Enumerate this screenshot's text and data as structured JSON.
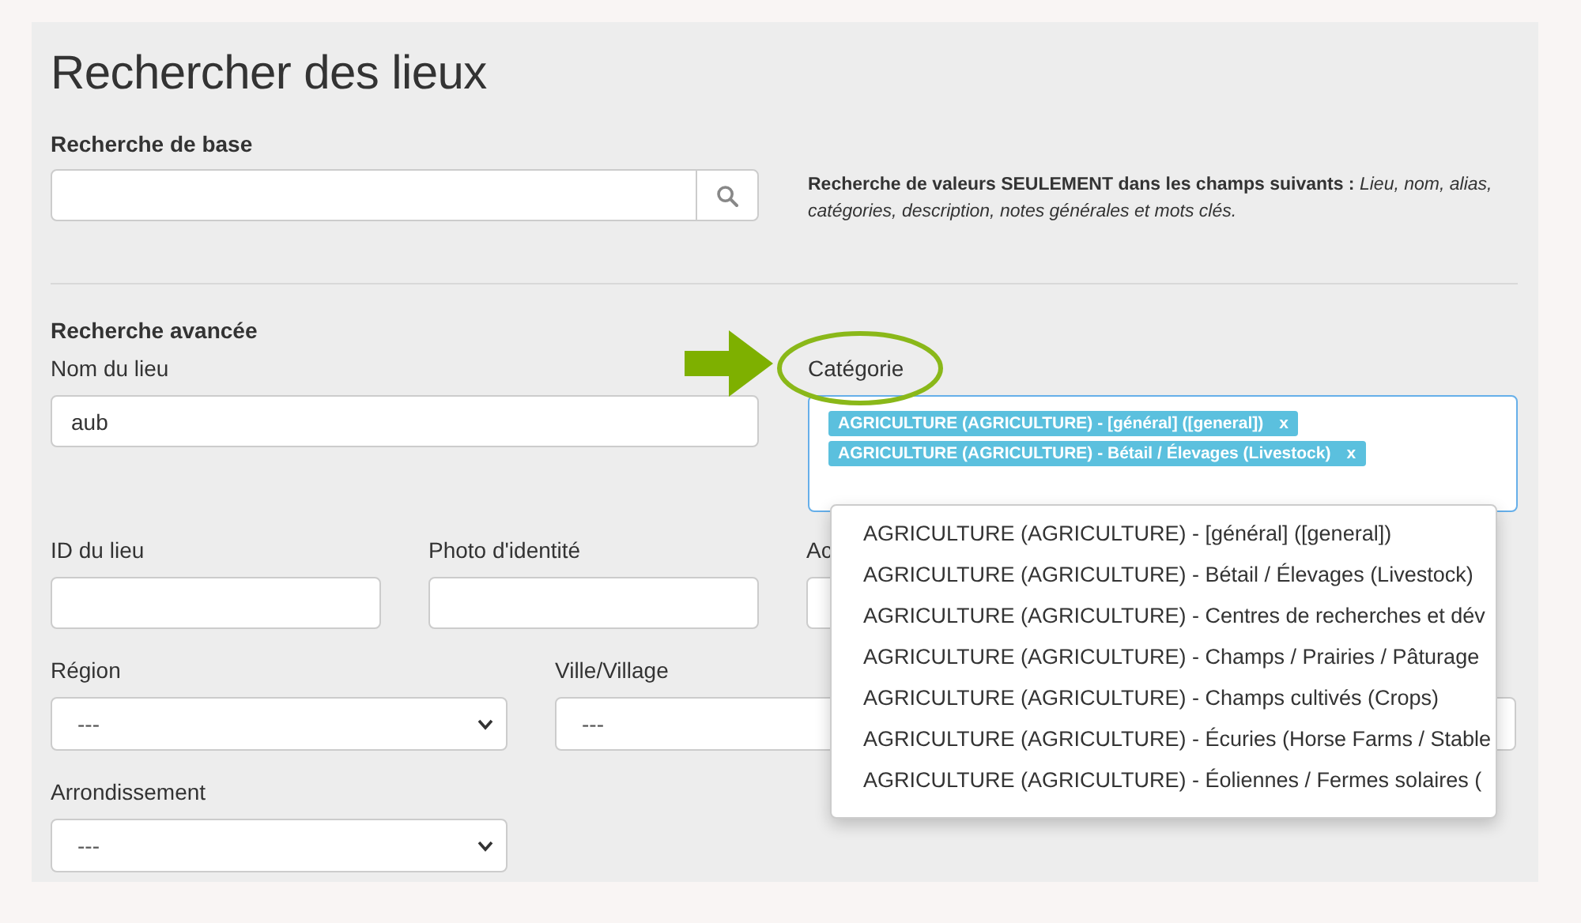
{
  "title": "Rechercher des lieux",
  "basic_search": {
    "label": "Recherche de base",
    "note": "**Recherche de valeurs SEULEMENT dans les champs suivants :** *Lieu, nom, alias, catégories, description, notes générales et mots clés.*"
  },
  "advanced_search": {
    "heading": "Recherche avancée",
    "place_name": {
      "label": "Nom du lieu",
      "value": "aub"
    },
    "category": {
      "label": "Catégorie",
      "tags": [
        {
          "text": "AGRICULTURE (AGRICULTURE) - [général] ([general])",
          "remove": "x"
        },
        {
          "text": "AGRICULTURE (AGRICULTURE) - Bétail / Élevages (Livestock)",
          "remove": "x"
        }
      ],
      "options": [
        "AGRICULTURE (AGRICULTURE) - [général] ([general])",
        "AGRICULTURE (AGRICULTURE) - Bétail / Élevages (Livestock)",
        "AGRICULTURE (AGRICULTURE) - Centres de recherches et dév",
        "AGRICULTURE (AGRICULTURE) - Champs / Prairies / Pâturage",
        "AGRICULTURE (AGRICULTURE) - Champs cultivés (Crops)",
        "AGRICULTURE (AGRICULTURE) - Écuries (Horse Farms / Stable",
        "AGRICULTURE (AGRICULTURE) - Éoliennes / Fermes solaires ("
      ]
    },
    "text_fields": [
      {
        "label": "ID du lieu"
      },
      {
        "label": "Photo d'identité"
      },
      {
        "label": "Ac"
      }
    ],
    "selects": [
      {
        "label": "Région",
        "value": "---"
      },
      {
        "label": "Ville/Village",
        "value": "---"
      },
      {
        "label": "Arrondissement",
        "value": "---"
      }
    ]
  }
}
